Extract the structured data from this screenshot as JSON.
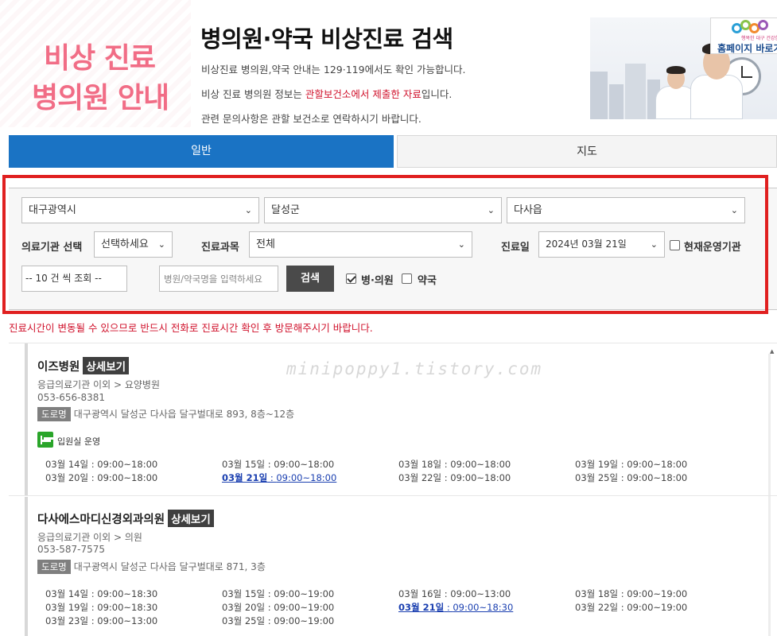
{
  "header": {
    "logo_line1": "비상 진료",
    "logo_line2": "병의원 안내",
    "title": "병의원·약국 비상진료 검색",
    "info1": "비상진료 병의원,약국 안내는 129·119에서도 확인 가능합니다.",
    "info2_pre": "비상 진료 병의원 정보는 ",
    "info2_red": "관할보건소에서 제출한 자료",
    "info2_post": "입니다.",
    "info3": "관련 문의사항은 관할 보건소로 연락하시기 바랍니다.",
    "home_sub": "행복한 대구 건강한 사람",
    "home_label": "홈페이지 바로가"
  },
  "tabs": {
    "general": "일반",
    "map": "지도"
  },
  "search": {
    "region": "대구광역시",
    "district": "달성군",
    "town": "다사읍",
    "facility_label": "의료기관 선택",
    "facility_value": "선택하세요",
    "dept_label": "진료과목",
    "dept_value": "전체",
    "date_label": "진료일",
    "date_value": "2024년 03월 21일",
    "open_now_label": "현재운영기관",
    "page_size": "-- 10 건 씩 조회 --",
    "name_placeholder": "병원/약국명을 입력하세요",
    "search_button": "검색",
    "hospital_label": "병·의원",
    "pharmacy_label": "약국"
  },
  "notice": "진료시간이 변동될 수 있으므로 반드시 전화로 진료시간 확인 후 방문해주시기 바랍니다.",
  "watermark": "minipoppy1.tistory.com",
  "results": [
    {
      "name": "이즈병원",
      "detail": "상세보기",
      "category": "응급의료기관 이외 > 요양병원",
      "phone": "053-656-8381",
      "road_tag": "도로명",
      "address": "대구광역시 달성군 다사읍 달구벌대로 893, 8층~12층",
      "inpatient": "입원실 운영",
      "schedule": [
        {
          "date": "03월 14일",
          "time": "09:00~18:00"
        },
        {
          "date": "03월 15일",
          "time": "09:00~18:00"
        },
        {
          "date": "03월 18일",
          "time": "09:00~18:00"
        },
        {
          "date": "03월 19일",
          "time": "09:00~18:00"
        },
        {
          "date": "03월 20일",
          "time": "09:00~18:00"
        },
        {
          "date": "03월 21일",
          "time": "09:00~18:00"
        },
        {
          "date": "03월 22일",
          "time": "09:00~18:00"
        },
        {
          "date": "03월 25일",
          "time": "09:00~18:00"
        }
      ]
    },
    {
      "name": "다사에스마디신경외과의원",
      "detail": "상세보기",
      "category": "응급의료기관 이외 > 의원",
      "phone": "053-587-7575",
      "road_tag": "도로명",
      "address": "대구광역시 달성군 다사읍 달구벌대로 871, 3층",
      "schedule": [
        {
          "date": "03월 14일",
          "time": "09:00~18:30"
        },
        {
          "date": "03월 15일",
          "time": "09:00~19:00"
        },
        {
          "date": "03월 16일",
          "time": "09:00~13:00"
        },
        {
          "date": "03월 18일",
          "time": "09:00~19:00"
        },
        {
          "date": "03월 19일",
          "time": "09:00~18:30"
        },
        {
          "date": "03월 20일",
          "time": "09:00~19:00"
        },
        {
          "date": "03월 21일",
          "time": "09:00~18:30"
        },
        {
          "date": "03월 22일",
          "time": "09:00~19:00"
        },
        {
          "date": "03월 23일",
          "time": "09:00~13:00"
        },
        {
          "date": "03월 25일",
          "time": "09:00~19:00"
        }
      ]
    }
  ],
  "sep": " : ",
  "colors": {
    "accent_blue": "#1a73c4",
    "logo_pink": "#f16d86",
    "notice_red": "#d0112b",
    "highlight_red": "#e02020",
    "inpatient_green": "#2aa52a"
  }
}
